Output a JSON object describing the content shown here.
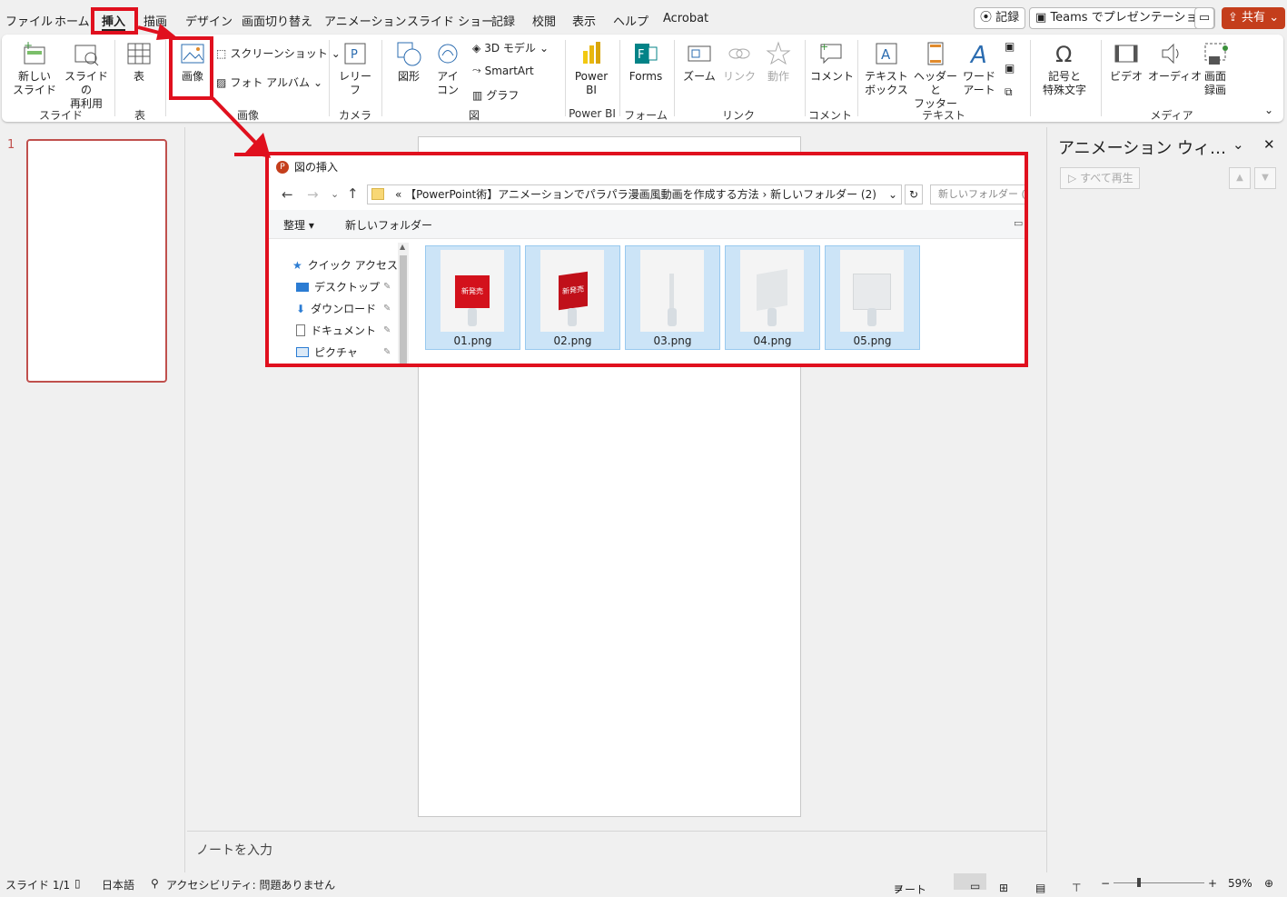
{
  "menubar": {
    "tabs": [
      "ファイル",
      "ホーム",
      "挿入",
      "描画",
      "デザイン",
      "画面切り替え",
      "アニメーション",
      "スライド ショー",
      "記録",
      "校閲",
      "表示",
      "ヘルプ",
      "Acrobat"
    ],
    "active_tab": "挿入",
    "record_button": "記録",
    "teams_button": "Teams でプレゼンテーション",
    "share_button": "共有"
  },
  "ribbon": {
    "new_slide": "新しい\nスライド",
    "reuse_slide": "スライドの\n再利用",
    "table": "表",
    "image": "画像",
    "screenshot": "スクリーンショット",
    "photo_album": "フォト アルバム",
    "cameo": "レリー\nフ",
    "shapes": "図形",
    "icons": "アイ\nコン",
    "model3d": "3D モデル",
    "smartart": "SmartArt",
    "chart": "グラフ",
    "powerbi": "Power\nBI",
    "forms": "Forms",
    "zoom": "ズーム",
    "link": "リンク",
    "action": "動作",
    "comment": "コメント",
    "textbox": "テキスト\nボックス",
    "header_footer": "ヘッダーと\nフッター",
    "wordart": "ワード\nアート",
    "symbols": "記号と\n特殊文字",
    "video": "ビデオ",
    "audio": "オーディオ",
    "screen_record": "画面\n録画",
    "groups": {
      "slides": "スライド",
      "tables": "表",
      "images": "画像",
      "camera": "カメラ",
      "illustrations": "図",
      "powerbi": "Power BI",
      "forms": "フォーム",
      "links": "リンク",
      "comments": "コメント",
      "text": "テキスト",
      "media": "メディア"
    }
  },
  "thumbnails": {
    "slide_number": "1"
  },
  "notes": {
    "placeholder": "ノートを入力"
  },
  "anim_pane": {
    "title": "アニメーション ウィ…",
    "play_all": "すべて再生"
  },
  "status": {
    "slide": "スライド 1/1",
    "language": "日本語",
    "accessibility": "アクセシビリティ: 問題ありません",
    "notes": "ノート",
    "zoom": "59%"
  },
  "dialog": {
    "title": "図の挿入",
    "path_prefix": "«",
    "path_folder": "【PowerPoint術】アニメーションでパラパラ漫画風動画を作成する方法",
    "path_sub": "新しいフォルダー (2)",
    "search_placeholder": "新しいフォルダー (2)の",
    "organize": "整理",
    "new_folder": "新しいフォルダー",
    "nav": [
      "クイック アクセス",
      "デスクトップ",
      "ダウンロード",
      "ドキュメント",
      "ピクチャ"
    ],
    "files": [
      "01.png",
      "02.png",
      "03.png",
      "04.png",
      "05.png"
    ],
    "thumb_text": "新発売"
  }
}
